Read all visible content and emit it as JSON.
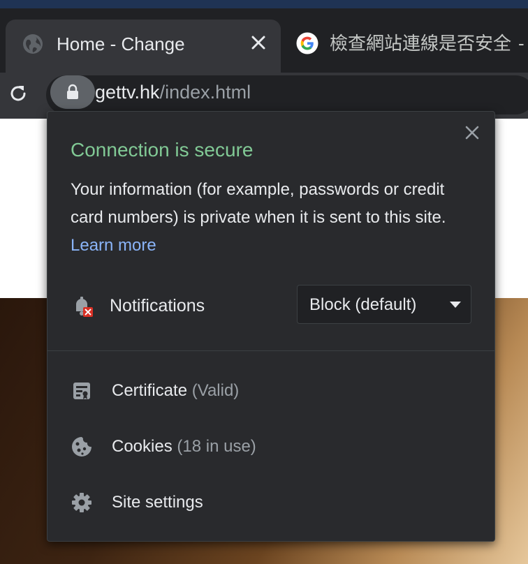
{
  "tabs": [
    {
      "title": "Home - Change",
      "active": true,
      "icon": "globe-icon"
    },
    {
      "title": "檢查網站連線是否安全",
      "suffix": "-",
      "active": false,
      "icon": "google-logo-icon"
    }
  ],
  "address_bar": {
    "host": "gettv.hk",
    "path": "/index.html",
    "icon": "lock-icon"
  },
  "site_info": {
    "heading": "Connection is secure",
    "description": "Your information (for example, passwords or credit card numbers) is private when it is sent to this site.",
    "learn_more": "Learn more",
    "notifications": {
      "label": "Notifications",
      "value": "Block (default)",
      "icon": "bell-blocked-icon"
    },
    "items": [
      {
        "label": "Certificate",
        "detail": "(Valid)",
        "icon": "certificate-icon"
      },
      {
        "label": "Cookies",
        "detail": "(18 in use)",
        "icon": "cookie-icon"
      },
      {
        "label": "Site settings",
        "detail": "",
        "icon": "gear-icon"
      }
    ]
  },
  "colors": {
    "secure_green": "#81c995",
    "link_blue": "#8ab4f8",
    "popup_bg": "#292a2d"
  }
}
